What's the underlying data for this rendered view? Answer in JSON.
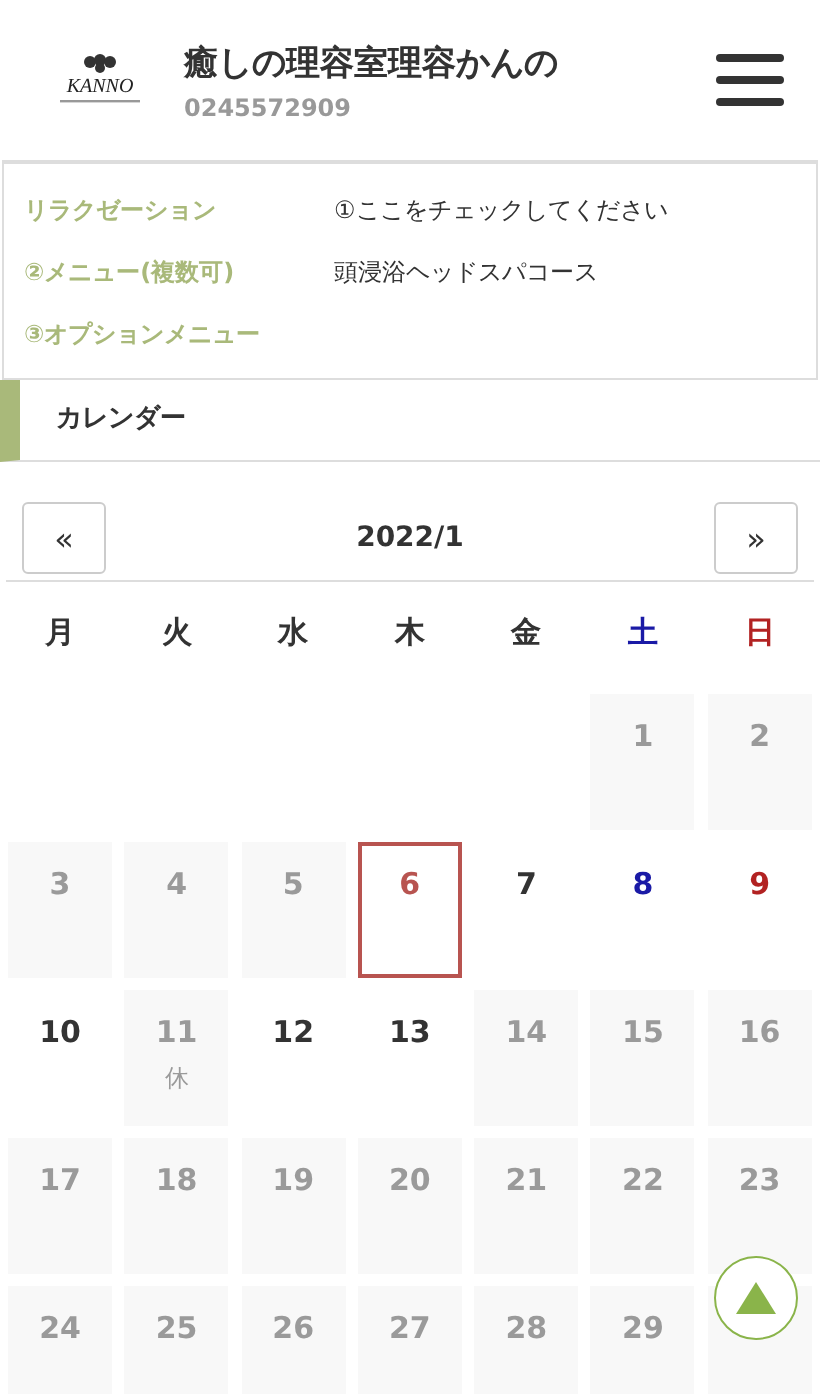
{
  "header": {
    "logo_text": "KANNO",
    "title": "癒しの理容室理容かんの",
    "phone": "0245572909"
  },
  "summary": [
    {
      "label": "リラクゼーション",
      "value": "①ここをチェックしてください"
    },
    {
      "label": "②メニュー(複数可)",
      "value": "頭浸浴ヘッドスパコース"
    },
    {
      "label": "③オプションメニュー"
    }
  ],
  "section_title": "カレンダー",
  "calendar": {
    "prev": "«",
    "month": "2022/1",
    "next": "»",
    "weekdays": [
      {
        "label": "月",
        "color": "#333333"
      },
      {
        "label": "火",
        "color": "#333333"
      },
      {
        "label": "水",
        "color": "#333333"
      },
      {
        "label": "木",
        "color": "#333333"
      },
      {
        "label": "金",
        "color": "#333333"
      },
      {
        "label": "土",
        "color": "#1a1aa6"
      },
      {
        "label": "日",
        "color": "#b22222"
      }
    ],
    "weeks": [
      [
        {
          "kind": "blank"
        },
        {
          "kind": "blank"
        },
        {
          "kind": "blank"
        },
        {
          "kind": "blank"
        },
        {
          "kind": "blank"
        },
        {
          "kind": "day",
          "day": "1",
          "available": false,
          "selected": false
        },
        {
          "kind": "day",
          "day": "2",
          "available": false,
          "selected": false
        }
      ],
      [
        {
          "kind": "day",
          "day": "3",
          "available": false,
          "selected": false
        },
        {
          "kind": "day",
          "day": "4",
          "available": false,
          "selected": false
        },
        {
          "kind": "day",
          "day": "5",
          "available": false,
          "selected": false
        },
        {
          "kind": "day",
          "day": "6",
          "available": true,
          "selected": true
        },
        {
          "kind": "day",
          "day": "7",
          "available": true,
          "selected": false
        },
        {
          "kind": "day",
          "day": "8",
          "available": true,
          "selected": false
        },
        {
          "kind": "day",
          "day": "9",
          "available": true,
          "selected": false
        }
      ],
      [
        {
          "kind": "day",
          "day": "10",
          "available": true,
          "selected": false
        },
        {
          "kind": "day",
          "day": "11",
          "available": false,
          "selected": false,
          "note": "休"
        },
        {
          "kind": "day",
          "day": "12",
          "available": true,
          "selected": false
        },
        {
          "kind": "day",
          "day": "13",
          "available": true,
          "selected": false
        },
        {
          "kind": "day",
          "day": "14",
          "available": false,
          "selected": false
        },
        {
          "kind": "day",
          "day": "15",
          "available": false,
          "selected": false
        },
        {
          "kind": "day",
          "day": "16",
          "available": false,
          "selected": false
        }
      ],
      [
        {
          "kind": "day",
          "day": "17",
          "available": false,
          "selected": false
        },
        {
          "kind": "day",
          "day": "18",
          "available": false,
          "selected": false
        },
        {
          "kind": "day",
          "day": "19",
          "available": false,
          "selected": false
        },
        {
          "kind": "day",
          "day": "20",
          "available": false,
          "selected": false
        },
        {
          "kind": "day",
          "day": "21",
          "available": false,
          "selected": false
        },
        {
          "kind": "day",
          "day": "22",
          "available": false,
          "selected": false
        },
        {
          "kind": "day",
          "day": "23",
          "available": false,
          "selected": false
        }
      ],
      [
        {
          "kind": "day",
          "day": "24",
          "available": false,
          "selected": false
        },
        {
          "kind": "day",
          "day": "25",
          "available": false,
          "selected": false
        },
        {
          "kind": "day",
          "day": "26",
          "available": false,
          "selected": false
        },
        {
          "kind": "day",
          "day": "27",
          "available": false,
          "selected": false
        },
        {
          "kind": "day",
          "day": "28",
          "available": false,
          "selected": false
        },
        {
          "kind": "day",
          "day": "29",
          "available": false,
          "selected": false
        },
        {
          "kind": "covered"
        }
      ]
    ]
  }
}
